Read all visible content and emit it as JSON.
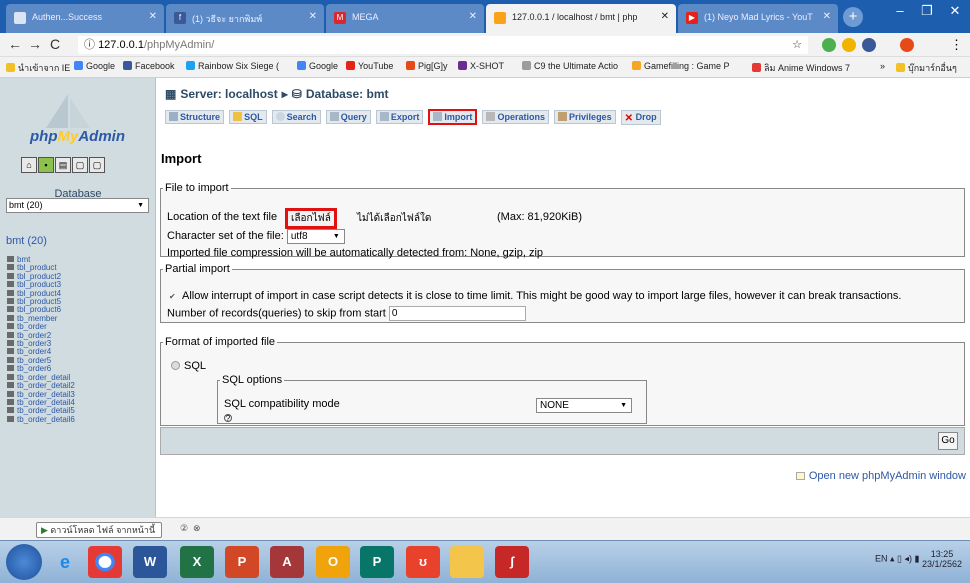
{
  "browser": {
    "tabs": [
      {
        "label": "Authen...Success",
        "color": "#dbe4f3"
      },
      {
        "label": "(1) วธีจะ ยากพิมพ์",
        "color": "#3b5998"
      },
      {
        "label": "MEGA",
        "color": "#d9272e"
      },
      {
        "label": "127.0.0.1 / localhost / bmt | php",
        "color": "#f9a21a"
      },
      {
        "label": "(1) Neyo Mad Lyrics - YouT",
        "color": "#e62117"
      }
    ],
    "url_host": "127.0.0.1",
    "url_path": "/phpMyAdmin/",
    "bookmarks": [
      "นำเข้าจาก IE",
      "Google",
      "Facebook",
      "Rainbow Six Siege (",
      "Google",
      "YouTube",
      "Pig[G]y",
      "X-SHOT",
      "C9 the Ultimate Actio",
      "Gamefilling : Game P",
      "ลิม Anime Windows 7",
      "บุ๊กมาร์กอื่นๆ"
    ],
    "overflow": "»"
  },
  "sidebar": {
    "logo_php": "php",
    "logo_my": "My",
    "logo_admin": "Admin",
    "database_label": "Database",
    "database_selected": "bmt (20)",
    "db_heading": "bmt (20)",
    "tables": [
      "bmt",
      "tbl_product",
      "tbl_product2",
      "tbl_product3",
      "tbl_product4",
      "tbl_product5",
      "tbl_product6",
      "tb_member",
      "tb_order",
      "tb_order2",
      "tb_order3",
      "tb_order4",
      "tb_order5",
      "tb_order6",
      "tb_order_detail",
      "tb_order_detail2",
      "tb_order_detail3",
      "tb_order_detail4",
      "tb_order_detail5",
      "tb_order_detail6"
    ]
  },
  "main": {
    "breadcrumb_server": "Server: localhost",
    "breadcrumb_sep": "▸",
    "breadcrumb_db": "Database: bmt",
    "tabs": [
      "Structure",
      "SQL",
      "Search",
      "Query",
      "Export",
      "Import",
      "Operations",
      "Privileges",
      "Drop"
    ],
    "page_title": "Import",
    "file_to_import": {
      "legend": "File to import",
      "location_label": "Location of the text file",
      "choose_button": "เลือกไฟล์",
      "no_file": "ไม่ได้เลือกไฟล์ใด",
      "max": "(Max: 81,920KiB)",
      "charset_label": "Character set of the file:",
      "charset_value": "utf8",
      "compression_note": "Imported file compression will be automatically detected from: None, gzip, zip"
    },
    "partial_import": {
      "legend": "Partial import",
      "allow_interrupt": "Allow interrupt of import in case script detects it is close to time limit. This might be good way to import large files, however it can break transactions.",
      "skip_label": "Number of records(queries) to skip from start",
      "skip_value": "0"
    },
    "format": {
      "legend": "Format of imported file",
      "sql_option": "SQL",
      "sql_options_legend": "SQL options",
      "compat_label": "SQL compatibility mode",
      "compat_value": "NONE"
    },
    "go_label": "Go",
    "new_window": "Open new phpMyAdmin window"
  },
  "download_bar": {
    "item": "ดาวน์โหลด ไฟล์ จากหน้านี้"
  },
  "taskbar": {
    "apps": [
      "IE",
      "Chrome",
      "Word",
      "Excel",
      "PowerPoint",
      "Access",
      "Outlook",
      "Publisher",
      "OneNote",
      "Explorer",
      "Acrobat"
    ],
    "lang": "EN",
    "time": "13:25",
    "date": "23/1/2562"
  }
}
